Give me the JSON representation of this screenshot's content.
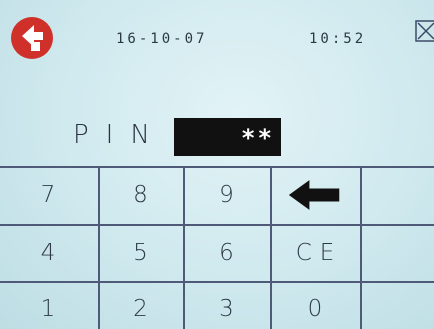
{
  "header": {
    "date": "16-10-07",
    "time": "10:52",
    "logo_icon": "brand-logo-icon",
    "close_icon": "close-icon"
  },
  "pin": {
    "label": "PIN",
    "masked_value": "**"
  },
  "keypad": {
    "rows": [
      [
        {
          "label": "7",
          "name": "key-7"
        },
        {
          "label": "8",
          "name": "key-8"
        },
        {
          "label": "9",
          "name": "key-9"
        },
        {
          "label": "",
          "name": "backspace-button",
          "icon": "left-arrow-icon"
        }
      ],
      [
        {
          "label": "4",
          "name": "key-4"
        },
        {
          "label": "5",
          "name": "key-5"
        },
        {
          "label": "6",
          "name": "key-6"
        },
        {
          "label": "CE",
          "name": "clear-entry-button"
        }
      ],
      [
        {
          "label": "1",
          "name": "key-1"
        },
        {
          "label": "2",
          "name": "key-2"
        },
        {
          "label": "3",
          "name": "key-3"
        },
        {
          "label": "0",
          "name": "key-0"
        }
      ]
    ]
  },
  "colors": {
    "background": "#cfe9ee",
    "logo_red": "#d0302a",
    "grid_line": "#4e5a78",
    "pin_field_bg": "#111111",
    "text": "#2e3a48"
  }
}
